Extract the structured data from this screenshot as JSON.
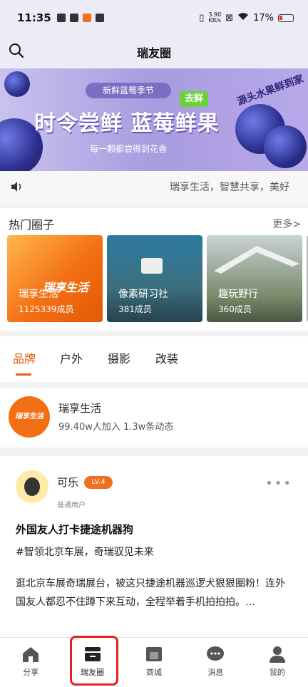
{
  "status_bar": {
    "time": "11:35",
    "net_speed_top": "3.90",
    "net_speed_bottom": "KB/s",
    "battery": "17%"
  },
  "header": {
    "title": "瑞友圈",
    "search_icon": "search-icon"
  },
  "banner": {
    "tag": "新鲜蓝莓季节",
    "headline": "时令尝鲜 蓝莓鲜果",
    "subline": "每一颗都尝得到花香",
    "side_text": "源头水果鲜到家",
    "badge": "去鲜"
  },
  "notice": {
    "text": "瑞享生活，智慧共享，美好"
  },
  "hot_circles": {
    "title": "热门圈子",
    "more": "更多>",
    "items": [
      {
        "name": "瑞享生活",
        "count": "1125339成员",
        "brand": "瑞享生活"
      },
      {
        "name": "像素研习社",
        "count": "381成员"
      },
      {
        "name": "趣玩野行",
        "count": "360成员"
      }
    ]
  },
  "tabs": [
    "品牌",
    "户外",
    "摄影",
    "改装"
  ],
  "active_tab": "品牌",
  "circle_info": {
    "avatar_text": "瑞享生活",
    "name": "瑞享生活",
    "stats": "99.40w人加入 1.3w条动态"
  },
  "post": {
    "username": "可乐",
    "level": "LV.4",
    "role": "普通用户",
    "more": "•••",
    "title": "外国友人打卡捷途机器狗",
    "topic": "#智领北京车展，奇瑞驭见未来",
    "body": "逛北京车展奇瑞展台，被这只捷途机器巡逻犬狠狠圈粉！连外国友人都忍不住蹲下来互动，全程举着手机拍拍拍。…"
  },
  "bottom_nav": [
    {
      "label": "分享",
      "icon": "share-icon"
    },
    {
      "label": "瑞友圈",
      "icon": "circle-icon"
    },
    {
      "label": "商城",
      "icon": "store-icon"
    },
    {
      "label": "消息",
      "icon": "message-icon"
    },
    {
      "label": "我的",
      "icon": "profile-icon"
    }
  ],
  "colors": {
    "accent": "#e65b12",
    "highlight": "#e62020"
  }
}
